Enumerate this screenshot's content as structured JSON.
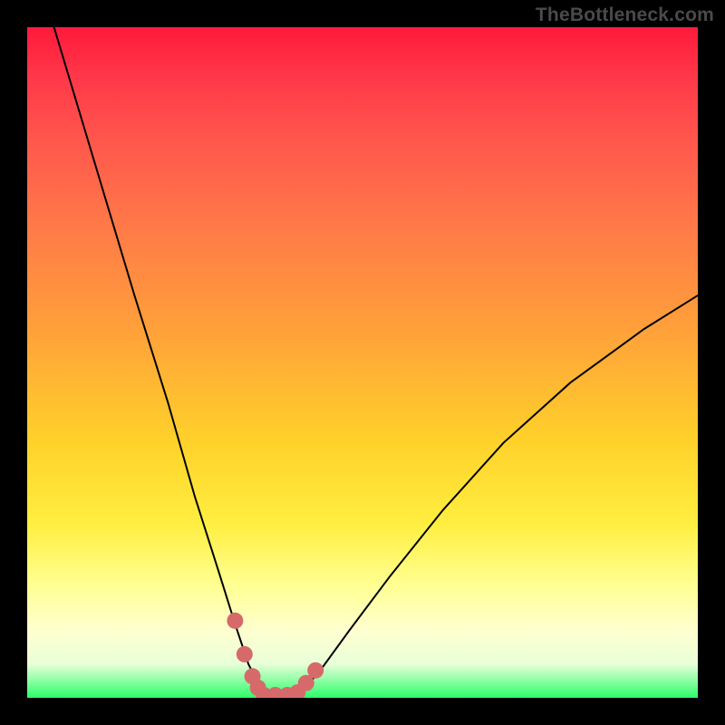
{
  "watermark": "TheBottleneck.com",
  "chart_data": {
    "type": "line",
    "title": "",
    "xlabel": "",
    "ylabel": "",
    "xlim": [
      0,
      100
    ],
    "ylim": [
      0,
      100
    ],
    "grid": false,
    "legend": false,
    "series": [
      {
        "name": "left-curve",
        "x": [
          4,
          10,
          16,
          21,
          25,
          28.5,
          31,
          33,
          34.8,
          35.5
        ],
        "values": [
          100,
          80,
          60,
          44,
          30,
          19,
          11,
          5,
          1.5,
          0
        ]
      },
      {
        "name": "right-curve",
        "x": [
          40,
          41.5,
          44,
          48,
          54,
          62,
          71,
          81,
          92,
          100
        ],
        "values": [
          0,
          1.5,
          4.5,
          10,
          18,
          28,
          38,
          47,
          55,
          60
        ]
      }
    ],
    "highlights": [
      {
        "name": "left-base-marker",
        "x": [
          31,
          32.4,
          33.6,
          34.4
        ],
        "values": [
          11.5,
          6.5,
          3.2,
          1.5
        ]
      },
      {
        "name": "floor-marker",
        "x": [
          35.3,
          37,
          38.8
        ],
        "values": [
          0.4,
          0.4,
          0.4
        ]
      },
      {
        "name": "right-base-marker",
        "x": [
          40.3,
          41.6,
          43.0
        ],
        "values": [
          0.8,
          2.2,
          4.1
        ]
      }
    ],
    "colors": {
      "curve": "#000000",
      "marker": "#d66a6a",
      "gradient_top": "#ff1a3c",
      "gradient_mid": "#ffd22a",
      "gradient_bottom": "#2bfd6a",
      "frame": "#000000"
    }
  }
}
